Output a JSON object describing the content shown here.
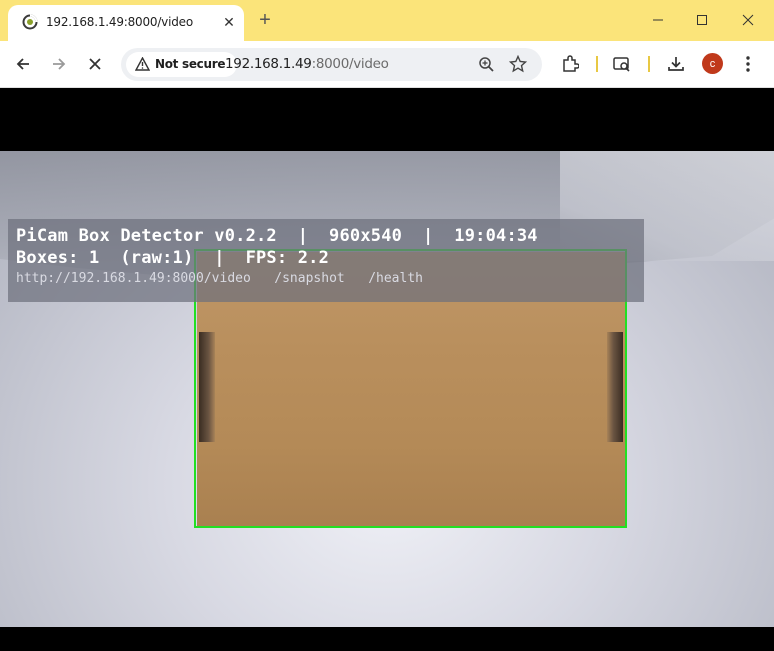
{
  "tab": {
    "title": "192.168.1.49:8000/video",
    "favicon": "loading-spinner-icon",
    "close": "✕",
    "new_tab": "+"
  },
  "window": {
    "minimize": "minimize-icon",
    "maximize": "maximize-icon",
    "close": "close-icon"
  },
  "toolbar": {
    "security_label": "Not secure",
    "url_host": "192.168.1.49",
    "url_rest": ":8000/video",
    "avatar_letter": "c"
  },
  "video_overlay": {
    "line1": "PiCam Box Detector v0.2.2  |  960x540  |  19:04:34",
    "line2": "Boxes: 1  (raw:1)  |  FPS: 2.2",
    "line3": "http://192.168.1.49:8000/video   /snapshot   /health"
  },
  "colors": {
    "tabstrip": "#fbe47a",
    "bbox": "#22e022",
    "avatar": "#c0391b"
  }
}
